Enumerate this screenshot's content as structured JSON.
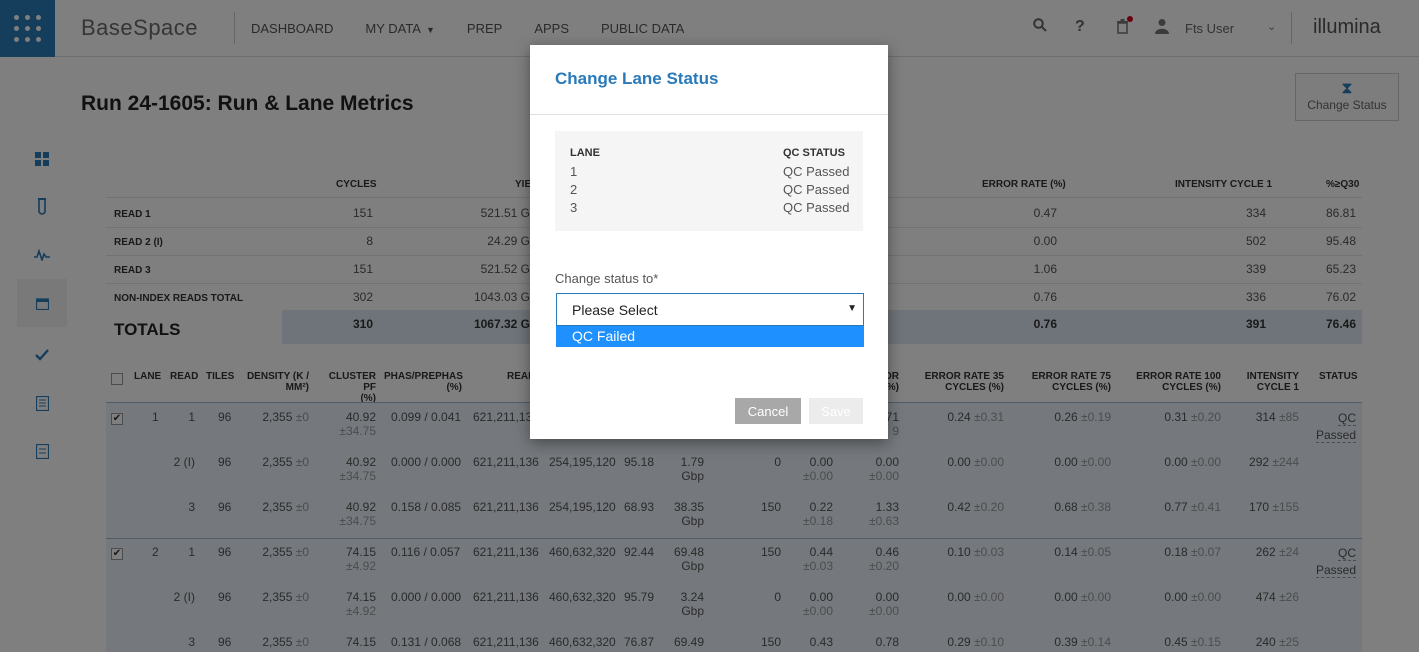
{
  "topbar": {
    "logo": "BaseSpace",
    "nav": [
      {
        "label": "DASHBOARD"
      },
      {
        "label": "MY DATA"
      },
      {
        "label": "PREP"
      },
      {
        "label": "APPS"
      },
      {
        "label": "PUBLIC DATA"
      }
    ],
    "user_name": "Fts User",
    "brand": "illumina",
    "brand_accent": "#f0a830"
  },
  "page": {
    "title": "Run 24-1605: Run & Lane Metrics",
    "change_status_label": "Change Status"
  },
  "metrics": {
    "headers": {
      "cycles": "CYCLES",
      "yield": "YIE",
      "error_rate": "ERROR RATE (%)",
      "intensity": "INTENSITY CYCLE 1",
      "q30": "%≥Q30"
    },
    "rows": [
      {
        "label": "READ 1",
        "cycles": "151",
        "yield": "521.51 G",
        "error": "0.47",
        "intensity": "334",
        "q30": "86.81"
      },
      {
        "label": "READ 2 (I)",
        "cycles": "8",
        "yield": "24.29 G",
        "error": "0.00",
        "intensity": "502",
        "q30": "95.48"
      },
      {
        "label": "READ 3",
        "cycles": "151",
        "yield": "521.52 G",
        "error": "1.06",
        "intensity": "339",
        "q30": "65.23"
      },
      {
        "label": "NON-INDEX READS TOTAL",
        "cycles": "302",
        "yield": "1043.03 G",
        "error": "0.76",
        "intensity": "336",
        "q30": "76.02"
      }
    ],
    "totals": {
      "label": "TOTALS",
      "cycles": "310",
      "yield": "1067.32 G",
      "error": "0.76",
      "intensity": "391",
      "q30": "76.46"
    }
  },
  "lanes_table": {
    "headers": {
      "lane": "LANE",
      "read": "READ",
      "tiles": "TILES",
      "density_1": "DENSITY (K /",
      "density_2": "MM²)",
      "cluster_1": "CLUSTER PF",
      "cluster_2": "(%)",
      "phas_1": "PHAS/PREPHAS",
      "phas_2": "(%)",
      "read_col": "READ",
      "or_1": "OR",
      "or_2": "%)",
      "er35_1": "ERROR RATE 35",
      "er35_2": "CYCLES (%)",
      "er75_1": "ERROR RATE 75",
      "er75_2": "CYCLES (%)",
      "er100_1": "ERROR RATE 100",
      "er100_2": "CYCLES (%)",
      "int_1": "INTENSITY",
      "int_2": "CYCLE 1",
      "status": "STATUS"
    },
    "lane1": {
      "lane": "1",
      "status_1": "QC",
      "status_2": "Passed",
      "rows": [
        {
          "read": "1",
          "tiles": "96",
          "density": "2,355",
          "density_sd": "±0",
          "cluster": "40.92",
          "cluster_sd": "±34.75",
          "phas": "0.099 / 0.041",
          "reads": "621,211,13",
          "er_tail": "71",
          "er_tail_sd": "9",
          "er35": "0.24",
          "er35_sd": "±0.31",
          "er75": "0.26",
          "er75_sd": "±0.19",
          "er100": "0.31",
          "er100_sd": "±0.20",
          "int": "314",
          "int_sd": "±85"
        },
        {
          "read": "2 (I)",
          "tiles": "96",
          "density": "2,355",
          "density_sd": "±0",
          "cluster": "40.92",
          "cluster_sd": "±34.75",
          "phas": "0.000 / 0.000",
          "reads": "621,211,136",
          "reads_pf": "254,195,120",
          "q30": "95.18",
          "yield": "1.79",
          "yield_unit": "Gbp",
          "aligned": "0",
          "err": "0.00",
          "err_sd": "±0.00",
          "err2": "0.00",
          "err2_sd": "±0.00",
          "er35": "0.00",
          "er35_sd": "±0.00",
          "er75": "0.00",
          "er75_sd": "±0.00",
          "er100": "0.00",
          "er100_sd": "±0.00",
          "int": "292",
          "int_sd": "±244"
        },
        {
          "read": "3",
          "tiles": "96",
          "density": "2,355",
          "density_sd": "±0",
          "cluster": "40.92",
          "cluster_sd": "±34.75",
          "phas": "0.158 / 0.085",
          "reads": "621,211,136",
          "reads_pf": "254,195,120",
          "q30": "68.93",
          "yield": "38.35",
          "yield_unit": "Gbp",
          "aligned": "150",
          "err": "0.22",
          "err_sd": "±0.18",
          "err2": "1.33",
          "err2_sd": "±0.63",
          "er35": "0.42",
          "er35_sd": "±0.20",
          "er75": "0.68",
          "er75_sd": "±0.38",
          "er100": "0.77",
          "er100_sd": "±0.41",
          "int": "170",
          "int_sd": "±155"
        }
      ]
    },
    "lane2": {
      "lane": "2",
      "status_1": "QC",
      "status_2": "Passed",
      "rows": [
        {
          "read": "1",
          "tiles": "96",
          "density": "2,355",
          "density_sd": "±0",
          "cluster": "74.15",
          "cluster_sd": "±4.92",
          "phas": "0.116 / 0.057",
          "reads": "621,211,136",
          "reads_pf": "460,632,320",
          "q30": "92.44",
          "yield": "69.48",
          "yield_unit": "Gbp",
          "aligned": "150",
          "err": "0.44",
          "err_sd": "±0.03",
          "err2": "0.46",
          "err2_sd": "±0.20",
          "er35": "0.10",
          "er35_sd": "±0.03",
          "er75": "0.14",
          "er75_sd": "±0.05",
          "er100": "0.18",
          "er100_sd": "±0.07",
          "int": "262",
          "int_sd": "±24"
        },
        {
          "read": "2 (I)",
          "tiles": "96",
          "density": "2,355",
          "density_sd": "±0",
          "cluster": "74.15",
          "cluster_sd": "±4.92",
          "phas": "0.000 / 0.000",
          "reads": "621,211,136",
          "reads_pf": "460,632,320",
          "q30": "95.79",
          "yield": "3.24",
          "yield_unit": "Gbp",
          "aligned": "0",
          "err": "0.00",
          "err_sd": "±0.00",
          "err2": "0.00",
          "err2_sd": "±0.00",
          "er35": "0.00",
          "er35_sd": "±0.00",
          "er75": "0.00",
          "er75_sd": "±0.00",
          "er100": "0.00",
          "er100_sd": "±0.00",
          "int": "474",
          "int_sd": "±26"
        },
        {
          "read": "3",
          "tiles": "96",
          "density": "2,355",
          "density_sd": "±0",
          "cluster": "74.15",
          "phas": "0.131 / 0.068",
          "reads": "621,211,136",
          "reads_pf": "460,632,320",
          "q30": "76.87",
          "yield": "69.49",
          "aligned": "150",
          "err": "0.43",
          "err2": "0.78",
          "er35": "0.29",
          "er35_sd": "±0.10",
          "er75": "0.39",
          "er75_sd": "±0.14",
          "er100": "0.45",
          "er100_sd": "±0.15",
          "int": "240",
          "int_sd": "±25"
        }
      ]
    }
  },
  "modal": {
    "title": "Change Lane Status",
    "lane_header": "LANE",
    "qc_header": "QC STATUS",
    "lanes": [
      {
        "lane": "1",
        "status": "QC Passed"
      },
      {
        "lane": "2",
        "status": "QC Passed"
      },
      {
        "lane": "3",
        "status": "QC Passed"
      }
    ],
    "change_label": "Change status to*",
    "select_value": "Please Select",
    "dropdown_option": "QC Failed",
    "cancel_label": "Cancel",
    "save_label": "Save"
  },
  "colors": {
    "primary": "#2a7ab9",
    "highlight": "#1e90ff",
    "lane_bg": "#eaf2fa",
    "totals_bg": "#dde9f3"
  },
  "icons": [
    "apps-grid-icon",
    "search-icon",
    "help-icon",
    "trash-icon",
    "user-icon",
    "chevron-down-icon",
    "hourglass-icon",
    "dashboard-icon",
    "flask-icon",
    "chart-icon",
    "calendar-icon",
    "check-icon",
    "list-icon",
    "document-icon"
  ]
}
